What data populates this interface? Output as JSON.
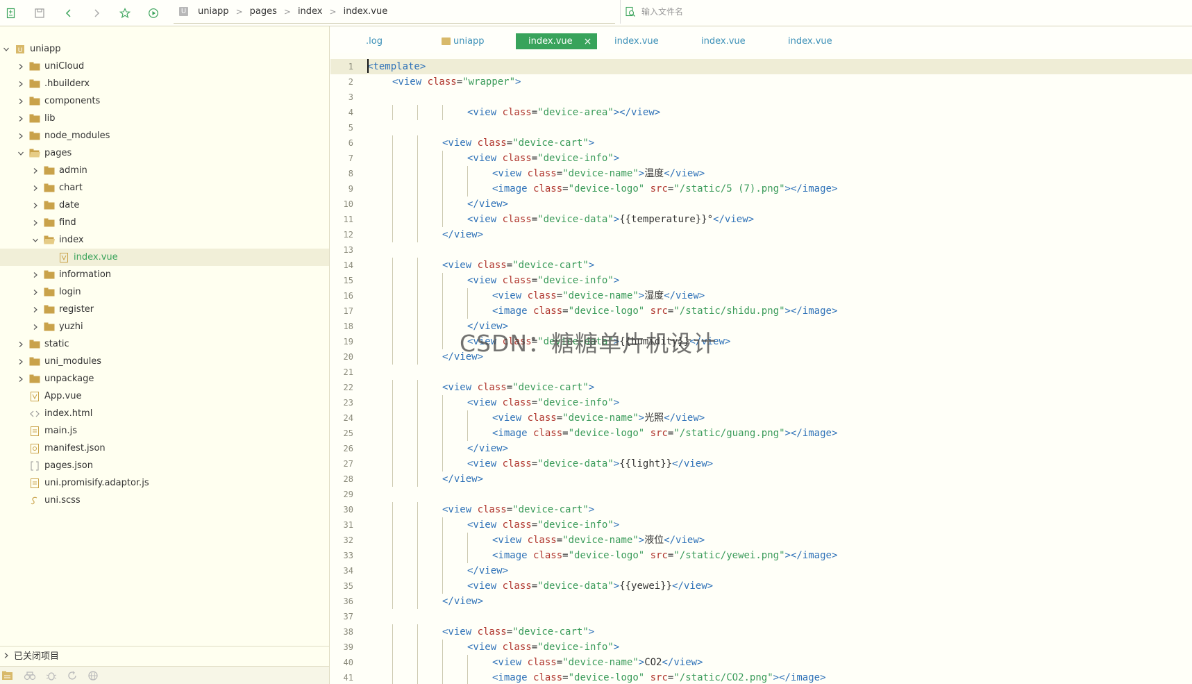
{
  "breadcrumb": [
    "uniapp",
    "pages",
    "index",
    "index.vue"
  ],
  "project_badge": "U",
  "search": {
    "placeholder": "输入文件名"
  },
  "tree": [
    {
      "label": "uniapp",
      "depth": 0,
      "kind": "project",
      "expanded": true
    },
    {
      "label": "uniCloud",
      "depth": 1,
      "kind": "folder-cloud",
      "expanded": false
    },
    {
      "label": ".hbuilderx",
      "depth": 1,
      "kind": "folder",
      "expanded": false
    },
    {
      "label": "components",
      "depth": 1,
      "kind": "folder",
      "expanded": false
    },
    {
      "label": "lib",
      "depth": 1,
      "kind": "folder",
      "expanded": false
    },
    {
      "label": "node_modules",
      "depth": 1,
      "kind": "folder",
      "expanded": false
    },
    {
      "label": "pages",
      "depth": 1,
      "kind": "folder-open",
      "expanded": true
    },
    {
      "label": "admin",
      "depth": 2,
      "kind": "folder",
      "expanded": false
    },
    {
      "label": "chart",
      "depth": 2,
      "kind": "folder",
      "expanded": false
    },
    {
      "label": "date",
      "depth": 2,
      "kind": "folder",
      "expanded": false
    },
    {
      "label": "find",
      "depth": 2,
      "kind": "folder",
      "expanded": false
    },
    {
      "label": "index",
      "depth": 2,
      "kind": "folder-open",
      "expanded": true
    },
    {
      "label": "index.vue",
      "depth": 3,
      "kind": "vue",
      "selected": true
    },
    {
      "label": "information",
      "depth": 2,
      "kind": "folder",
      "expanded": false
    },
    {
      "label": "login",
      "depth": 2,
      "kind": "folder",
      "expanded": false
    },
    {
      "label": "register",
      "depth": 2,
      "kind": "folder",
      "expanded": false
    },
    {
      "label": "yuzhi",
      "depth": 2,
      "kind": "folder",
      "expanded": false
    },
    {
      "label": "static",
      "depth": 1,
      "kind": "folder",
      "expanded": false
    },
    {
      "label": "uni_modules",
      "depth": 1,
      "kind": "folder",
      "expanded": false
    },
    {
      "label": "unpackage",
      "depth": 1,
      "kind": "folder",
      "expanded": false
    },
    {
      "label": "App.vue",
      "depth": 1,
      "kind": "vue"
    },
    {
      "label": "index.html",
      "depth": 1,
      "kind": "html"
    },
    {
      "label": "main.js",
      "depth": 1,
      "kind": "js"
    },
    {
      "label": "manifest.json",
      "depth": 1,
      "kind": "manifest"
    },
    {
      "label": "pages.json",
      "depth": 1,
      "kind": "json"
    },
    {
      "label": "uni.promisify.adaptor.js",
      "depth": 1,
      "kind": "js"
    },
    {
      "label": "uni.scss",
      "depth": 1,
      "kind": "scss"
    }
  ],
  "closed_projects_label": "已关闭项目",
  "tabs": [
    {
      "label": ".log",
      "active": false,
      "folder": false
    },
    {
      "label": "uniapp",
      "active": false,
      "folder": true
    },
    {
      "label": "index.vue",
      "active": true,
      "folder": false
    },
    {
      "label": "index.vue",
      "active": false,
      "folder": false
    },
    {
      "label": "index.vue",
      "active": false,
      "folder": false
    },
    {
      "label": "index.vue",
      "active": false,
      "folder": false
    }
  ],
  "tab_close_symbol": "×",
  "code_lines": [
    {
      "indent": 0,
      "segs": [
        [
          "tg",
          "<template>"
        ]
      ]
    },
    {
      "indent": 1,
      "segs": [
        [
          "tg",
          "<view "
        ],
        [
          "at",
          "class"
        ],
        [
          "tx",
          "="
        ],
        [
          "st",
          "\"wrapper\""
        ],
        [
          "tg",
          ">"
        ]
      ]
    },
    {
      "indent": 0,
      "segs": []
    },
    {
      "indent": 4,
      "segs": [
        [
          "tg",
          "<view "
        ],
        [
          "at",
          "class"
        ],
        [
          "tx",
          "="
        ],
        [
          "st",
          "\"device-area\""
        ],
        [
          "tg",
          "></view>"
        ]
      ]
    },
    {
      "indent": 0,
      "segs": []
    },
    {
      "indent": 3,
      "segs": [
        [
          "tg",
          "<view "
        ],
        [
          "at",
          "class"
        ],
        [
          "tx",
          "="
        ],
        [
          "st",
          "\"device-cart\""
        ],
        [
          "tg",
          ">"
        ]
      ]
    },
    {
      "indent": 4,
      "segs": [
        [
          "tg",
          "<view "
        ],
        [
          "at",
          "class"
        ],
        [
          "tx",
          "="
        ],
        [
          "st",
          "\"device-info\""
        ],
        [
          "tg",
          ">"
        ]
      ]
    },
    {
      "indent": 5,
      "segs": [
        [
          "tg",
          "<view "
        ],
        [
          "at",
          "class"
        ],
        [
          "tx",
          "="
        ],
        [
          "st",
          "\"device-name\""
        ],
        [
          "tg",
          ">"
        ],
        [
          "tx",
          "温度"
        ],
        [
          "tg",
          "</view>"
        ]
      ]
    },
    {
      "indent": 5,
      "segs": [
        [
          "tg",
          "<image "
        ],
        [
          "at",
          "class"
        ],
        [
          "tx",
          "="
        ],
        [
          "st",
          "\"device-logo\""
        ],
        [
          "tx",
          " "
        ],
        [
          "at",
          "src"
        ],
        [
          "tx",
          "="
        ],
        [
          "st",
          "\"/static/5 (7).png\""
        ],
        [
          "tg",
          "></image>"
        ]
      ]
    },
    {
      "indent": 4,
      "segs": [
        [
          "tg",
          "</view>"
        ]
      ]
    },
    {
      "indent": 4,
      "segs": [
        [
          "tg",
          "<view "
        ],
        [
          "at",
          "class"
        ],
        [
          "tx",
          "="
        ],
        [
          "st",
          "\"device-data\""
        ],
        [
          "tg",
          ">"
        ],
        [
          "tx",
          "{{temperature}}°"
        ],
        [
          "tg",
          "</view>"
        ]
      ]
    },
    {
      "indent": 3,
      "segs": [
        [
          "tg",
          "</view>"
        ]
      ]
    },
    {
      "indent": 0,
      "segs": []
    },
    {
      "indent": 3,
      "segs": [
        [
          "tg",
          "<view "
        ],
        [
          "at",
          "class"
        ],
        [
          "tx",
          "="
        ],
        [
          "st",
          "\"device-cart\""
        ],
        [
          "tg",
          ">"
        ]
      ]
    },
    {
      "indent": 4,
      "segs": [
        [
          "tg",
          "<view "
        ],
        [
          "at",
          "class"
        ],
        [
          "tx",
          "="
        ],
        [
          "st",
          "\"device-info\""
        ],
        [
          "tg",
          ">"
        ]
      ]
    },
    {
      "indent": 5,
      "segs": [
        [
          "tg",
          "<view "
        ],
        [
          "at",
          "class"
        ],
        [
          "tx",
          "="
        ],
        [
          "st",
          "\"device-name\""
        ],
        [
          "tg",
          ">"
        ],
        [
          "tx",
          "湿度"
        ],
        [
          "tg",
          "</view>"
        ]
      ]
    },
    {
      "indent": 5,
      "segs": [
        [
          "tg",
          "<image "
        ],
        [
          "at",
          "class"
        ],
        [
          "tx",
          "="
        ],
        [
          "st",
          "\"device-logo\""
        ],
        [
          "tx",
          " "
        ],
        [
          "at",
          "src"
        ],
        [
          "tx",
          "="
        ],
        [
          "st",
          "\"/static/shidu.png\""
        ],
        [
          "tg",
          "></image>"
        ]
      ]
    },
    {
      "indent": 4,
      "segs": [
        [
          "tg",
          "</view>"
        ]
      ]
    },
    {
      "indent": 4,
      "segs": [
        [
          "tg",
          "<view "
        ],
        [
          "at",
          "class"
        ],
        [
          "tx",
          "="
        ],
        [
          "st",
          "\"device-data\""
        ],
        [
          "tg",
          ">"
        ],
        [
          "tx",
          "{{humidity}}"
        ],
        [
          "tg",
          "</view>"
        ]
      ]
    },
    {
      "indent": 3,
      "segs": [
        [
          "tg",
          "</view>"
        ]
      ]
    },
    {
      "indent": 0,
      "segs": []
    },
    {
      "indent": 3,
      "segs": [
        [
          "tg",
          "<view "
        ],
        [
          "at",
          "class"
        ],
        [
          "tx",
          "="
        ],
        [
          "st",
          "\"device-cart\""
        ],
        [
          "tg",
          ">"
        ]
      ]
    },
    {
      "indent": 4,
      "segs": [
        [
          "tg",
          "<view "
        ],
        [
          "at",
          "class"
        ],
        [
          "tx",
          "="
        ],
        [
          "st",
          "\"device-info\""
        ],
        [
          "tg",
          ">"
        ]
      ]
    },
    {
      "indent": 5,
      "segs": [
        [
          "tg",
          "<view "
        ],
        [
          "at",
          "class"
        ],
        [
          "tx",
          "="
        ],
        [
          "st",
          "\"device-name\""
        ],
        [
          "tg",
          ">"
        ],
        [
          "tx",
          "光照"
        ],
        [
          "tg",
          "</view>"
        ]
      ]
    },
    {
      "indent": 5,
      "segs": [
        [
          "tg",
          "<image "
        ],
        [
          "at",
          "class"
        ],
        [
          "tx",
          "="
        ],
        [
          "st",
          "\"device-logo\""
        ],
        [
          "tx",
          " "
        ],
        [
          "at",
          "src"
        ],
        [
          "tx",
          "="
        ],
        [
          "st",
          "\"/static/guang.png\""
        ],
        [
          "tg",
          "></image>"
        ]
      ]
    },
    {
      "indent": 4,
      "segs": [
        [
          "tg",
          "</view>"
        ]
      ]
    },
    {
      "indent": 4,
      "segs": [
        [
          "tg",
          "<view "
        ],
        [
          "at",
          "class"
        ],
        [
          "tx",
          "="
        ],
        [
          "st",
          "\"device-data\""
        ],
        [
          "tg",
          ">"
        ],
        [
          "tx",
          "{{light}}"
        ],
        [
          "tg",
          "</view>"
        ]
      ]
    },
    {
      "indent": 3,
      "segs": [
        [
          "tg",
          "</view>"
        ]
      ]
    },
    {
      "indent": 0,
      "segs": []
    },
    {
      "indent": 3,
      "segs": [
        [
          "tg",
          "<view "
        ],
        [
          "at",
          "class"
        ],
        [
          "tx",
          "="
        ],
        [
          "st",
          "\"device-cart\""
        ],
        [
          "tg",
          ">"
        ]
      ]
    },
    {
      "indent": 4,
      "segs": [
        [
          "tg",
          "<view "
        ],
        [
          "at",
          "class"
        ],
        [
          "tx",
          "="
        ],
        [
          "st",
          "\"device-info\""
        ],
        [
          "tg",
          ">"
        ]
      ]
    },
    {
      "indent": 5,
      "segs": [
        [
          "tg",
          "<view "
        ],
        [
          "at",
          "class"
        ],
        [
          "tx",
          "="
        ],
        [
          "st",
          "\"device-name\""
        ],
        [
          "tg",
          ">"
        ],
        [
          "tx",
          "液位"
        ],
        [
          "tg",
          "</view>"
        ]
      ]
    },
    {
      "indent": 5,
      "segs": [
        [
          "tg",
          "<image "
        ],
        [
          "at",
          "class"
        ],
        [
          "tx",
          "="
        ],
        [
          "st",
          "\"device-logo\""
        ],
        [
          "tx",
          " "
        ],
        [
          "at",
          "src"
        ],
        [
          "tx",
          "="
        ],
        [
          "st",
          "\"/static/yewei.png\""
        ],
        [
          "tg",
          "></image>"
        ]
      ]
    },
    {
      "indent": 4,
      "segs": [
        [
          "tg",
          "</view>"
        ]
      ]
    },
    {
      "indent": 4,
      "segs": [
        [
          "tg",
          "<view "
        ],
        [
          "at",
          "class"
        ],
        [
          "tx",
          "="
        ],
        [
          "st",
          "\"device-data\""
        ],
        [
          "tg",
          ">"
        ],
        [
          "tx",
          "{{yewei}}"
        ],
        [
          "tg",
          "</view>"
        ]
      ]
    },
    {
      "indent": 3,
      "segs": [
        [
          "tg",
          "</view>"
        ]
      ]
    },
    {
      "indent": 0,
      "segs": []
    },
    {
      "indent": 3,
      "segs": [
        [
          "tg",
          "<view "
        ],
        [
          "at",
          "class"
        ],
        [
          "tx",
          "="
        ],
        [
          "st",
          "\"device-cart\""
        ],
        [
          "tg",
          ">"
        ]
      ]
    },
    {
      "indent": 4,
      "segs": [
        [
          "tg",
          "<view "
        ],
        [
          "at",
          "class"
        ],
        [
          "tx",
          "="
        ],
        [
          "st",
          "\"device-info\""
        ],
        [
          "tg",
          ">"
        ]
      ]
    },
    {
      "indent": 5,
      "segs": [
        [
          "tg",
          "<view "
        ],
        [
          "at",
          "class"
        ],
        [
          "tx",
          "="
        ],
        [
          "st",
          "\"device-name\""
        ],
        [
          "tg",
          ">"
        ],
        [
          "tx",
          "CO2"
        ],
        [
          "tg",
          "</view>"
        ]
      ]
    },
    {
      "indent": 5,
      "segs": [
        [
          "tg",
          "<image "
        ],
        [
          "at",
          "class"
        ],
        [
          "tx",
          "="
        ],
        [
          "st",
          "\"device-logo\""
        ],
        [
          "tx",
          " "
        ],
        [
          "at",
          "src"
        ],
        [
          "tx",
          "="
        ],
        [
          "st",
          "\"/static/CO2.png\""
        ],
        [
          "tg",
          "></image>"
        ]
      ]
    }
  ],
  "watermark": "CSDN：糖糖单片机设计",
  "colors": {
    "accent": "#38a35b",
    "tag": "#2f72b8",
    "attr": "#b0362e",
    "string": "#3a9b5a",
    "sidebar_bg": "#fffff0",
    "editor_bg": "#fffff8"
  }
}
